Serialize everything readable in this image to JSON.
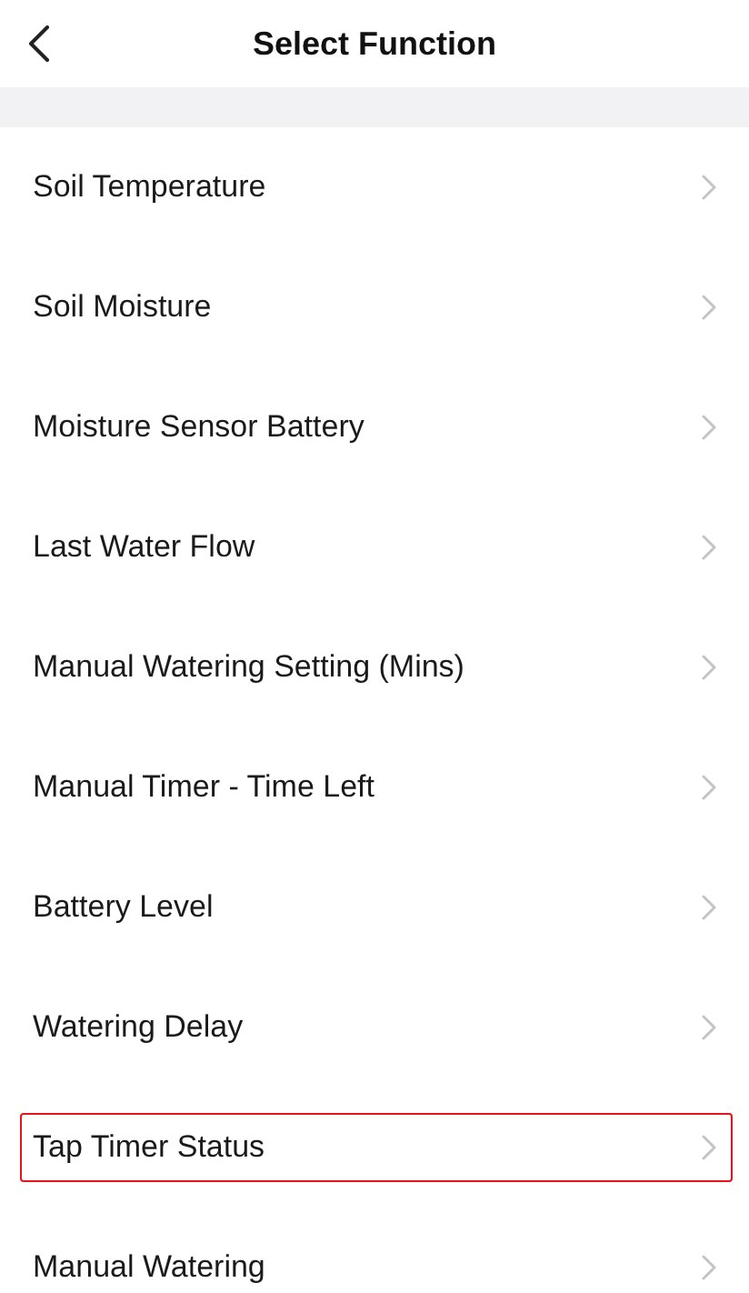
{
  "header": {
    "title": "Select Function"
  },
  "functions": [
    {
      "label": "Soil Temperature",
      "selected": false
    },
    {
      "label": "Soil Moisture",
      "selected": false
    },
    {
      "label": "Moisture Sensor Battery",
      "selected": false
    },
    {
      "label": "Last Water Flow",
      "selected": false
    },
    {
      "label": "Manual Watering Setting (Mins)",
      "selected": false
    },
    {
      "label": "Manual Timer - Time Left",
      "selected": false
    },
    {
      "label": "Battery Level",
      "selected": false
    },
    {
      "label": "Watering Delay",
      "selected": false
    },
    {
      "label": "Tap Timer Status",
      "selected": true
    },
    {
      "label": "Manual Watering",
      "selected": false
    }
  ]
}
